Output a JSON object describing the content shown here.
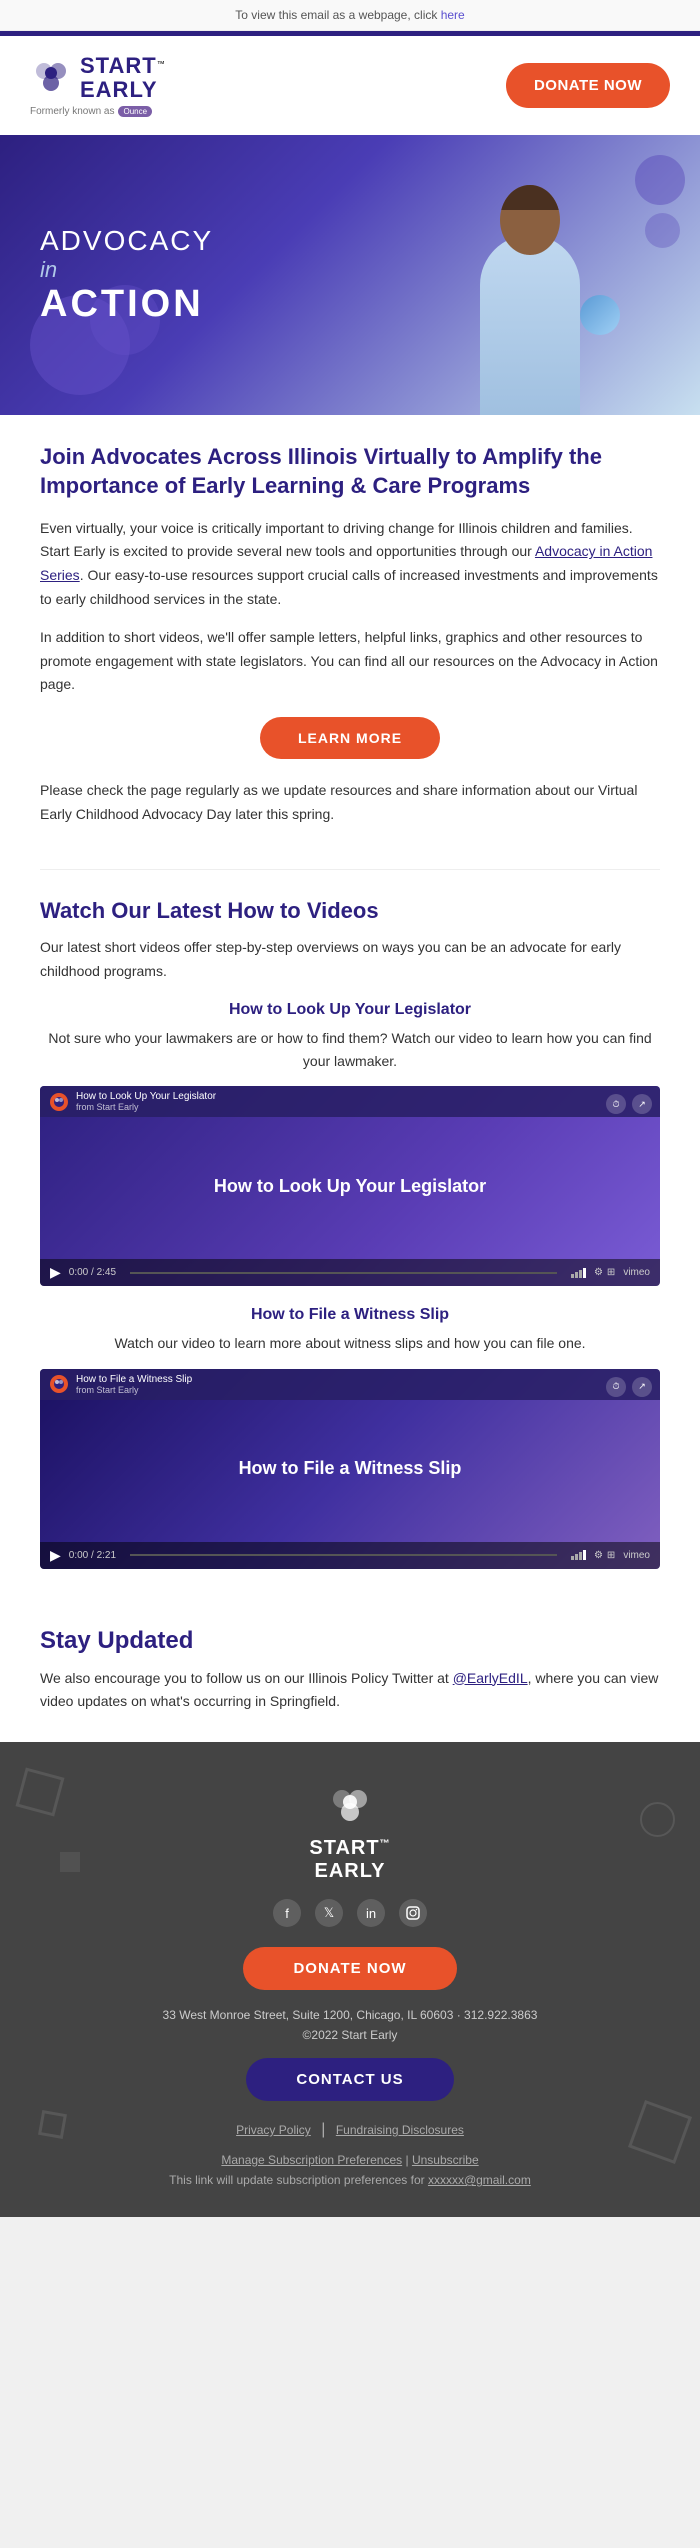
{
  "topbar": {
    "text": "To view this email as a webpage, click ",
    "link_text": "here"
  },
  "header": {
    "logo_start": "START",
    "logo_early": "EARLY",
    "logo_tm": "™",
    "formerly_text": "Formerly known as",
    "formerly_badge": "Ounce",
    "donate_label": "DONATE NOW"
  },
  "hero": {
    "advocacy": "ADVOCACY",
    "in_text": "in",
    "action": "ACTION"
  },
  "main": {
    "heading": "Join Advocates Across Illinois Virtually to Amplify the Importance of Early Learning & Care Programs",
    "intro_p1": "Even virtually, your voice is critically important to driving change for Illinois children and families. Start Early is excited to provide several new tools and opportunities through our ",
    "advocacy_link": "Advocacy in Action Series",
    "intro_p1_end": ". Our easy-to-use resources support crucial calls of increased investments and improvements to early childhood services in the state.",
    "intro_p2": "In addition to short videos, we'll offer sample letters, helpful links, graphics and other resources to promote engagement with state legislators. You can find all our resources on the Advocacy in Action page.",
    "learn_more_label": "LEARN MORE",
    "check_text": "Please check the page regularly as we update resources and share information about our Virtual Early Childhood Advocacy Day later this spring.",
    "videos_heading": "Watch Our Latest How to Videos",
    "videos_desc": "Our latest short videos offer step-by-step overviews on ways you can be an advocate for early childhood programs.",
    "video1_title": "How to Look Up Your Legislator",
    "video1_desc": "Not sure who your lawmakers are or how to find them? Watch our video to learn how you can find your lawmaker.",
    "video1_label": "How to Look Up Your Legislator",
    "video1_top_text": "How to Look Up Your Legislator",
    "video1_source": "from Start Early",
    "video1_time": "0:00 / 2:45",
    "video2_title": "How to File a Witness Slip",
    "video2_desc": "Watch our video to learn more about witness slips and how you can file one.",
    "video2_label": "How to File a Witness Slip",
    "video2_top_text": "How to File a Witness Slip",
    "video2_source": "from Start Early",
    "video2_time": "0:00 / 2:21"
  },
  "stay_updated": {
    "heading": "Stay Updated",
    "text_before": "We also encourage you to follow us on our Illinois Policy Twitter at ",
    "twitter_handle": "@EarlyEdIL",
    "text_after": ", where you can view video updates on what's occurring in Springfield."
  },
  "footer": {
    "logo_start": "START",
    "logo_early": "EARLY",
    "logo_tm": "™",
    "social_icons": [
      "f",
      "t",
      "in",
      "ig"
    ],
    "donate_label": "DONATE NOW",
    "address": "33 West Monroe Street, Suite 1200, Chicago, IL 60603 · 312.922.3863",
    "copyright": "©2022 Start Early",
    "contact_label": "CONTACT US",
    "privacy_label": "Privacy Policy",
    "fundraising_label": "Fundraising Disclosures",
    "manage_label": "Manage Subscription Preferences",
    "unsubscribe_label": "Unsubscribe",
    "update_text": "This link will update subscription preferences for ",
    "update_email": "xxxxxx@gmail.com"
  }
}
